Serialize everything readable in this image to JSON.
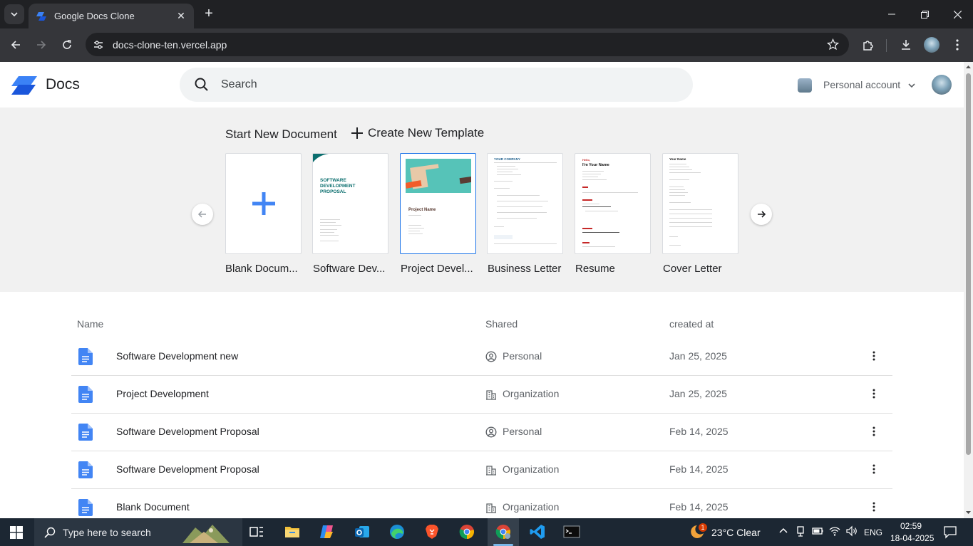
{
  "browser": {
    "tab_title": "Google Docs Clone",
    "new_tab_symbol": "+",
    "url": "docs-clone-ten.vercel.app"
  },
  "header": {
    "app_name": "Docs",
    "search_placeholder": "Search",
    "account_label": "Personal account"
  },
  "templates": {
    "start_label": "Start New Document",
    "create_label": "Create New Template",
    "items": [
      {
        "label": "Blank Docum..."
      },
      {
        "label": "Software Dev..."
      },
      {
        "label": "Project Devel..."
      },
      {
        "label": "Business Letter"
      },
      {
        "label": "Resume"
      },
      {
        "label": "Cover Letter"
      }
    ],
    "previews": {
      "proposal_title": "SOFTWARE DEVELOPMENT PROPOSAL",
      "project_title": "Project Name",
      "company": "YOUR COMPANY",
      "resume_hello": "Hello,",
      "resume_name": "I'm Your Name",
      "cover_name": "Your Name"
    }
  },
  "documents": {
    "columns": {
      "name": "Name",
      "shared": "Shared",
      "created": "created at"
    },
    "rows": [
      {
        "name": "Software Development new",
        "shared": "Personal",
        "shared_icon": "user-circle-icon",
        "created": "Jan 25, 2025"
      },
      {
        "name": "Project Development",
        "shared": "Organization",
        "shared_icon": "building-icon",
        "created": "Jan 25, 2025"
      },
      {
        "name": "Software Development Proposal",
        "shared": "Personal",
        "shared_icon": "user-circle-icon",
        "created": "Feb 14, 2025"
      },
      {
        "name": "Software Development Proposal",
        "shared": "Organization",
        "shared_icon": "building-icon",
        "created": "Feb 14, 2025"
      },
      {
        "name": "Blank Document",
        "shared": "Organization",
        "shared_icon": "building-icon",
        "created": "Feb 14, 2025"
      }
    ]
  },
  "taskbar": {
    "search_placeholder": "Type here to search",
    "weather_badge": "1",
    "weather": "23°C  Clear",
    "language": "ENG",
    "time": "02:59",
    "date": "18-04-2025"
  },
  "colors": {
    "accent": "#1a73e8",
    "doc_icon": "#4285f4",
    "logo_dark": "#1a56db",
    "logo_light": "#3b82f6",
    "template_bg": "#f1f1f1"
  }
}
